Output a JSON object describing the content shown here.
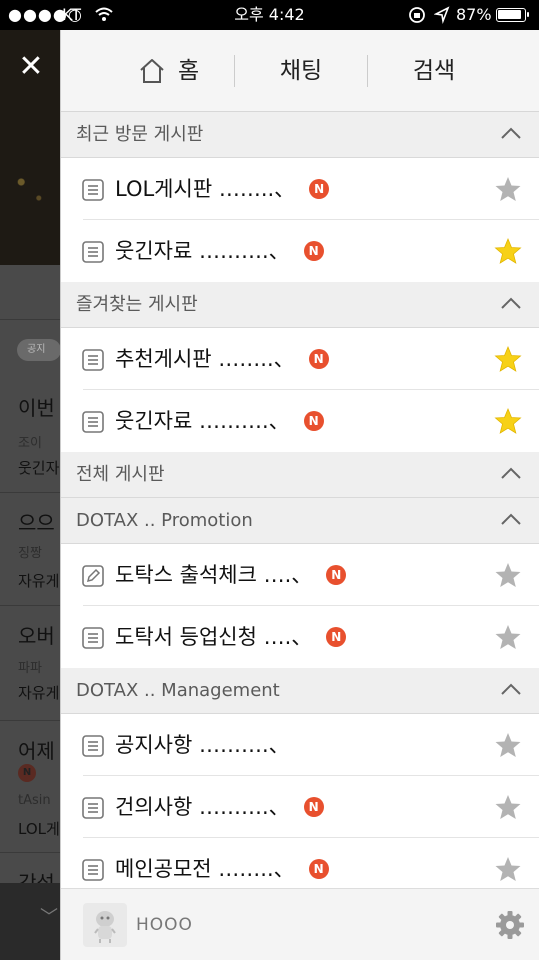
{
  "status_bar": {
    "signal": "●●●●○",
    "carrier": "KT",
    "wifi_icon": "wifi-icon",
    "time": "오후 4:42",
    "battery": "87%"
  },
  "background": {
    "chip": "공지",
    "items": [
      {
        "title": "이번",
        "sub": "조이",
        "board": "웃긴자"
      },
      {
        "title": "으으",
        "sub": "징짱",
        "board": "자유게"
      },
      {
        "title": "오버",
        "sub": "파파",
        "board": "자유게"
      },
      {
        "title": "어제",
        "sub": "tAsin",
        "board": "LOL게"
      },
      {
        "title": "갓섭",
        "sub": "",
        "board": ""
      }
    ]
  },
  "tabs": {
    "home": "홈",
    "chat": "채팅",
    "search": "검색"
  },
  "sections": [
    {
      "title": "최근 방문 게시판",
      "items": [
        {
          "label": "LOL게시판 ……..、",
          "badge": "N",
          "starred": false
        },
        {
          "label": "웃긴자료 ……….、",
          "badge": "N",
          "starred": true
        }
      ]
    },
    {
      "title": "즐겨찾는 게시판",
      "items": [
        {
          "label": "추천게시판 ……..、",
          "badge": "N",
          "starred": true
        },
        {
          "label": "웃긴자료 ……….、",
          "badge": "N",
          "starred": true
        }
      ]
    },
    {
      "title": "전체 게시판",
      "items": []
    },
    {
      "title": "DOTAX .. Promotion",
      "items": [
        {
          "label": "도탁스 출석체크 ….、",
          "badge": "N",
          "starred": false,
          "icon": "pencil"
        },
        {
          "label": "도탁서 등업신청 ….、",
          "badge": "N",
          "starred": false
        }
      ]
    },
    {
      "title": "DOTAX .. Management",
      "items": [
        {
          "label": "공지사항 ……….、",
          "badge": "",
          "starred": false
        },
        {
          "label": "건의사항 ……….、",
          "badge": "N",
          "starred": false
        },
        {
          "label": "메인공모전 ……..、",
          "badge": "N",
          "starred": false
        }
      ]
    }
  ],
  "footer": {
    "username": "HOOO"
  },
  "colors": {
    "badge": "#e8502e",
    "star_on": "#f7d117",
    "star_off": "#b3b3b3",
    "section_bg": "#efefef"
  }
}
